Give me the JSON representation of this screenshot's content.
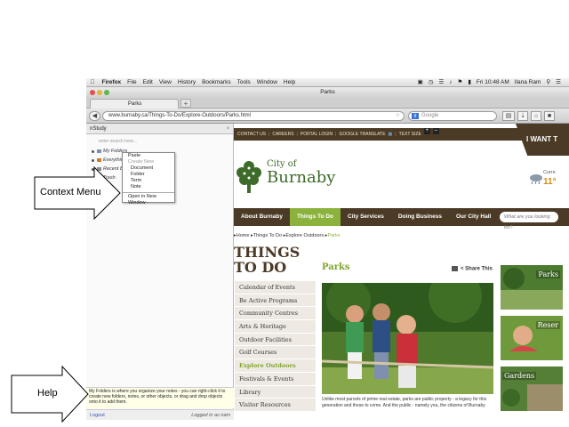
{
  "menubar": {
    "app": "Firefox",
    "items": [
      "File",
      "Edit",
      "View",
      "History",
      "Bookmarks",
      "Tools",
      "Window",
      "Help"
    ],
    "clock": "Fri 10:48 AM",
    "user": "Ilana Ram"
  },
  "browser": {
    "window_title": "Parks",
    "tab_title": "Parks",
    "new_tab": "+",
    "url": "www.burnaby.ca/Things-To-Do/Explore-Outdoors/Parks.html",
    "search_placeholder": "Google"
  },
  "nstudy": {
    "header": "nStudy",
    "search_placeholder": "enter search here...",
    "tree": [
      "My Folders",
      "Everything",
      "Recent Boo",
      "Trash"
    ],
    "context_menu": {
      "paste": "Paste",
      "create_new": "Create New",
      "document": "Document",
      "folder": "Folder",
      "term": "Term",
      "note": "Note",
      "open_window": "Open in New Window"
    },
    "help_text": "My Folders is where you organize your notes - you can right-click it to create new folders, notes, or other objects, or drag and drop objects onto it to add them.",
    "logout": "Logout",
    "logged_in_as": "Logged in as iram"
  },
  "site": {
    "top_links": [
      "CONTACT US",
      "CAREERS",
      "PORTAL LOGIN",
      "GOOGLE TRANSLATE",
      "TEXT SIZE"
    ],
    "i_want": "I WANT T",
    "logo_city": "City of",
    "logo_name": "Burnaby",
    "weather_label": "Curre",
    "weather_temp": "11°",
    "nav": [
      "About Burnaby",
      "Things To Do",
      "City Services",
      "Doing Business",
      "Our City Hall"
    ],
    "nav_search": "What are you looking for?",
    "breadcrumb": {
      "home": "Home",
      "section": "Things To Do",
      "sub": "Explore Outdoors",
      "current": "Parks"
    },
    "heading": "THINGS TO DO",
    "side_nav": [
      "Calendar of Events",
      "Be Active Programs",
      "Community Centres",
      "Arts & Heritage",
      "Outdoor Facilities",
      "Golf Courses",
      "Explore Outdoors",
      "Festivals & Events",
      "Library",
      "Visitor Resources"
    ],
    "page_title": "Parks",
    "share": "Share This",
    "body_text": "Unlike most parcels of prime real estate, parks are public property - a legacy for this generation and those to come. And the public - namely you, the citizens of Burnaby",
    "thumbs": [
      "Parks",
      "Reser",
      "Gardens"
    ]
  },
  "callouts": {
    "context_menu": "Context Menu",
    "help": "Help"
  }
}
